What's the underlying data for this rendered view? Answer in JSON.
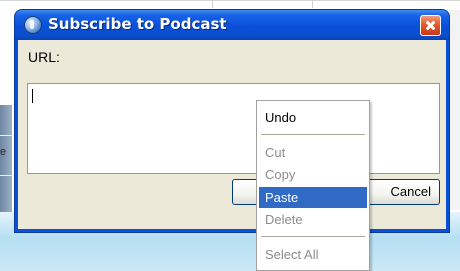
{
  "dialog": {
    "title": "Subscribe to Podcast",
    "url_label": "URL:",
    "url_value": "",
    "ok_label": "",
    "cancel_label": "Cancel"
  },
  "context_menu": {
    "items": [
      {
        "label": "Undo",
        "enabled": true,
        "selected": false
      },
      {
        "label": "Cut",
        "enabled": false,
        "selected": false
      },
      {
        "label": "Copy",
        "enabled": false,
        "selected": false
      },
      {
        "label": "Paste",
        "enabled": true,
        "selected": true
      },
      {
        "label": "Delete",
        "enabled": false,
        "selected": false
      },
      {
        "label": "Select All",
        "enabled": false,
        "selected": false
      }
    ]
  },
  "background": {
    "edge_text": "e"
  },
  "colors": {
    "titlebar": "#0a4fd8",
    "dialog_face": "#ece9d8",
    "menu_highlight": "#316ac5",
    "close_button": "#e35b2e"
  },
  "icons": {
    "title_icon": "podcast-icon",
    "close_icon": "close-icon"
  }
}
